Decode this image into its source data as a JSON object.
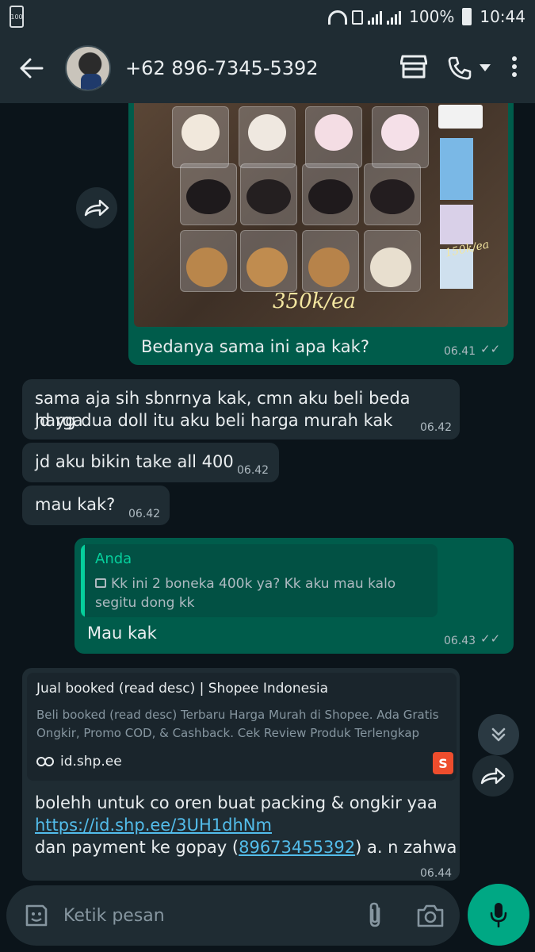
{
  "status_bar": {
    "battery_left": "100",
    "battery_percent": "100%",
    "time": "10:44"
  },
  "header": {
    "contact": "+62 896-7345-5392"
  },
  "messages": {
    "m1": {
      "overlay_price_large": "350k/ea",
      "overlay_price_small": "150k/ea",
      "text": "Bedanya sama ini apa kak?",
      "time": "06.41"
    },
    "m2": {
      "line1": "sama aja sih sbnrnya kak, cmn aku beli beda harga",
      "line2": "jd yg dua doll itu aku beli harga murah kak",
      "time": "06.42"
    },
    "m3": {
      "text": "jd aku bikin take all 400",
      "time": "06.42"
    },
    "m4": {
      "text": "mau kak?",
      "time": "06.42"
    },
    "m5": {
      "reply_author": "Anda",
      "reply_text": "Kk ini 2 boneka 400k ya? Kk aku mau kalo segitu dong kk",
      "text": "Mau kak",
      "time": "06.43"
    },
    "m6": {
      "preview_title": "Jual booked (read desc) | Shopee Indonesia",
      "preview_desc": "Beli booked (read desc) Terbaru Harga Murah di Shopee. Ada Gratis Ongkir, Promo COD, & Cashback. Cek Review Produk Terlengkap",
      "preview_url": "id.shp.ee",
      "shop_icon_letter": "S",
      "line1": "bolehh untuk co oren buat packing & ongkir yaa",
      "link": "https://id.shp.ee/3UH1dhNm",
      "line3_pre": "dan payment ke gopay (",
      "phone": "89673455392",
      "line3_post": ") a. n zahwa",
      "time": "06.44"
    }
  },
  "input": {
    "placeholder": "Ketik pesan"
  },
  "colors": {
    "background": "#0b141a",
    "bar": "#1f2c33",
    "outgoing": "#005c4b",
    "incoming": "#1f2c33",
    "accent": "#00a884",
    "link": "#53bdeb"
  }
}
